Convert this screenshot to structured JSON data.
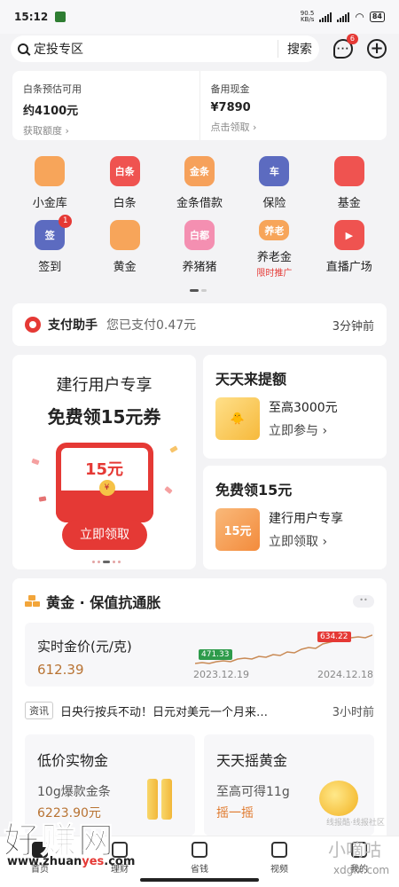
{
  "status_bar": {
    "time": "15:12",
    "net_speed": "90.5",
    "net_unit": "KB/s",
    "battery": "84"
  },
  "search": {
    "query": "定投专区",
    "button": "搜索",
    "msg_badge": "6"
  },
  "credit": {
    "left": {
      "label": "白条预估可用",
      "value": "约4100元",
      "link": "获取额度"
    },
    "right": {
      "label": "备用现金",
      "value": "¥7890",
      "link": "点击领取"
    }
  },
  "grid": [
    {
      "label": "小金库",
      "icon": "piggy-bag-icon",
      "color": "#f7a55a",
      "glyph": ""
    },
    {
      "label": "白条",
      "icon": "baitiao-icon",
      "color": "#ef5350",
      "glyph": "白条"
    },
    {
      "label": "金条借款",
      "icon": "gold-loan-icon",
      "color": "#f6a15b",
      "glyph": "金条"
    },
    {
      "label": "保险",
      "icon": "insurance-shield-icon",
      "color": "#5c6bc0",
      "glyph": "车"
    },
    {
      "label": "基金",
      "icon": "fund-chart-icon",
      "color": "#ef5350",
      "glyph": ""
    },
    {
      "label": "签到",
      "icon": "checkin-icon",
      "color": "#5c6bc0",
      "glyph": "签",
      "badge": "1"
    },
    {
      "label": "黄金",
      "icon": "gold-bars-icon",
      "color": "#f7a55a",
      "glyph": ""
    },
    {
      "label": "养猪猪",
      "icon": "pig-icon",
      "color": "#f48fb1",
      "glyph": "白都"
    },
    {
      "label": "养老金",
      "icon": "pension-icon",
      "color": "#f7a55a",
      "glyph": "养老",
      "sub": "限时推广"
    },
    {
      "label": "直播广场",
      "icon": "live-play-icon",
      "color": "#ef5350",
      "glyph": "▶"
    }
  ],
  "payment": {
    "title": "支付助手",
    "text": "您已支付0.47元",
    "time": "3分钟前"
  },
  "promo_left": {
    "title": "建行用户专享",
    "headline": "免费领15元券",
    "amount": "15元",
    "coin": "¥",
    "button": "立即领取"
  },
  "promo_right_top": {
    "title": "天天来提额",
    "line1": "至高3000元",
    "line2": "立即参与"
  },
  "promo_right_bottom": {
    "title": "免费领15元",
    "thumb": "15元",
    "line1": "建行用户专享",
    "line2": "立即领取"
  },
  "gold": {
    "title": "黄金 · 保值抗通胀",
    "price_label": "实时金价(元/克)",
    "price_value": "612.39",
    "chart_low": "471.33",
    "chart_high": "634.22",
    "date_start": "2023.12.19",
    "date_end": "2024.12.18",
    "news_tag": "资讯",
    "news_text": "日央行按兵不动！日元对美元一个月来…",
    "news_time": "3小时前",
    "card1": {
      "title": "低价实物金",
      "line1": "10g爆款金条",
      "line2": "6223.90元"
    },
    "card2": {
      "title": "天天摇黄金",
      "line1": "至高可得11g",
      "line2": "摇一摇"
    }
  },
  "nav": [
    {
      "label": "首页",
      "icon": "home-icon",
      "active": true
    },
    {
      "label": "理财",
      "icon": "wealth-icon"
    },
    {
      "label": "省钱",
      "icon": "save-money-icon"
    },
    {
      "label": "视频",
      "icon": "video-icon"
    },
    {
      "label": "我的",
      "icon": "profile-icon"
    }
  ],
  "watermarks": {
    "big": "好赚网",
    "url_a": "www.zhuan",
    "url_b": "yes",
    "url_c": ".com",
    "right_big": "小嘀咕",
    "right_small": "线报酷·线报社区",
    "right_url": "xdgfx.com"
  },
  "colors": {
    "accent_red": "#e53935",
    "gold": "#b87333"
  }
}
